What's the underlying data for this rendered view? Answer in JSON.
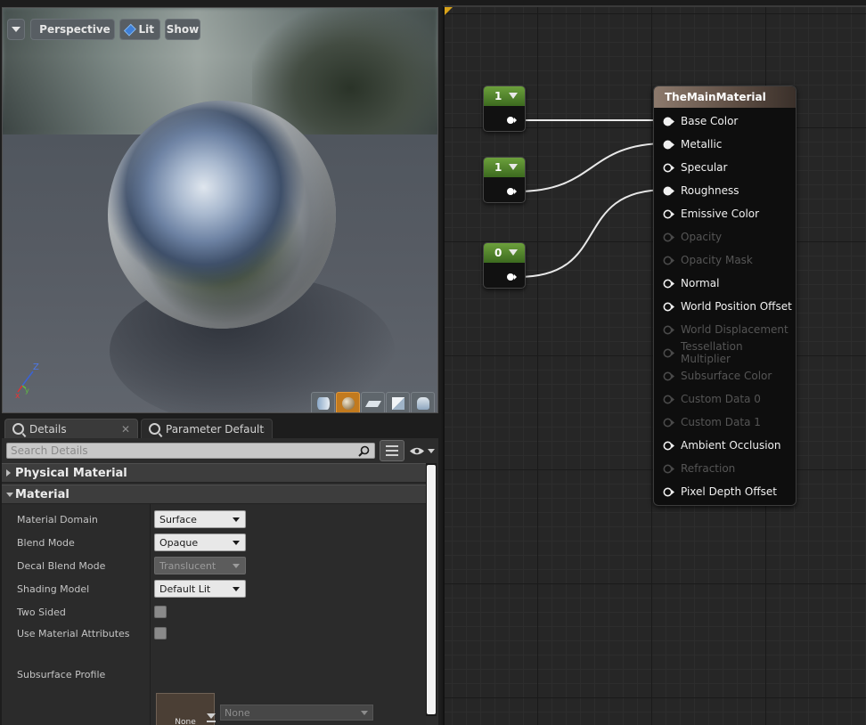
{
  "viewport": {
    "perspective_label": "Perspective",
    "lit_label": "Lit",
    "show_label": "Show"
  },
  "details": {
    "tabs": [
      {
        "label": "Details",
        "close": "✕"
      },
      {
        "label": "Parameter Defaults",
        "close": ""
      }
    ],
    "search": {
      "placeholder": "Search Details"
    },
    "categories": {
      "physical_material": "Physical Material",
      "material": "Material"
    },
    "properties": [
      {
        "label": "Material Domain",
        "value": "Surface"
      },
      {
        "label": "Blend Mode",
        "value": "Opaque"
      },
      {
        "label": "Decal Blend Mode",
        "value": "Translucent"
      },
      {
        "label": "Shading Model",
        "value": "Default Lit"
      },
      {
        "label": "Two Sided",
        "checked": false
      },
      {
        "label": "Use Material Attributes",
        "checked": false
      },
      {
        "label": "Subsurface Profile",
        "thumb": "None",
        "combo": "None"
      }
    ]
  },
  "graph": {
    "constants": [
      {
        "value": "1"
      },
      {
        "value": "1"
      },
      {
        "value": "0"
      }
    ],
    "main_node": {
      "title": "TheMainMaterial",
      "pins": [
        {
          "label": "Base Color",
          "active": true,
          "connected": true
        },
        {
          "label": "Metallic",
          "active": true,
          "connected": true
        },
        {
          "label": "Specular",
          "active": true,
          "connected": false
        },
        {
          "label": "Roughness",
          "active": true,
          "connected": true
        },
        {
          "label": "Emissive Color",
          "active": true,
          "connected": false
        },
        {
          "label": "Opacity",
          "active": false,
          "connected": false
        },
        {
          "label": "Opacity Mask",
          "active": false,
          "connected": false
        },
        {
          "label": "Normal",
          "active": true,
          "connected": false
        },
        {
          "label": "World Position Offset",
          "active": true,
          "connected": false
        },
        {
          "label": "World Displacement",
          "active": false,
          "connected": false
        },
        {
          "label": "Tessellation Multiplier",
          "active": false,
          "connected": false
        },
        {
          "label": "Subsurface Color",
          "active": false,
          "connected": false
        },
        {
          "label": "Custom Data 0",
          "active": false,
          "connected": false
        },
        {
          "label": "Custom Data 1",
          "active": false,
          "connected": false
        },
        {
          "label": "Ambient Occlusion",
          "active": true,
          "connected": false
        },
        {
          "label": "Refraction",
          "active": false,
          "connected": false
        },
        {
          "label": "Pixel Depth Offset",
          "active": true,
          "connected": false
        }
      ]
    }
  }
}
